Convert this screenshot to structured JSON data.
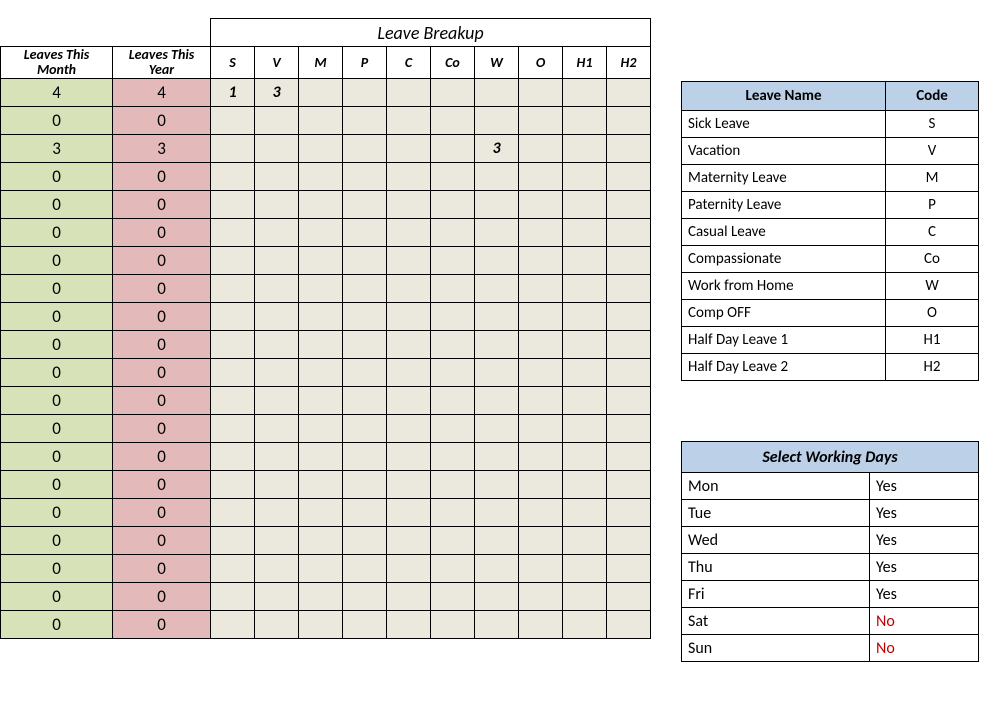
{
  "main": {
    "breakup_title": "Leave Breakup",
    "headers": {
      "month": "Leaves This Month",
      "year": "Leaves This Year",
      "codes": [
        "S",
        "V",
        "M",
        "P",
        "C",
        "Co",
        "W",
        "O",
        "H1",
        "H2"
      ]
    },
    "rows": [
      {
        "m": "4",
        "y": "4",
        "b": [
          "1",
          "3",
          "",
          "",
          "",
          "",
          "",
          "",
          "",
          ""
        ]
      },
      {
        "m": "0",
        "y": "0",
        "b": [
          "",
          "",
          "",
          "",
          "",
          "",
          "",
          "",
          "",
          ""
        ]
      },
      {
        "m": "3",
        "y": "3",
        "b": [
          "",
          "",
          "",
          "",
          "",
          "",
          "3",
          "",
          "",
          ""
        ]
      },
      {
        "m": "0",
        "y": "0",
        "b": [
          "",
          "",
          "",
          "",
          "",
          "",
          "",
          "",
          "",
          ""
        ]
      },
      {
        "m": "0",
        "y": "0",
        "b": [
          "",
          "",
          "",
          "",
          "",
          "",
          "",
          "",
          "",
          ""
        ]
      },
      {
        "m": "0",
        "y": "0",
        "b": [
          "",
          "",
          "",
          "",
          "",
          "",
          "",
          "",
          "",
          ""
        ]
      },
      {
        "m": "0",
        "y": "0",
        "b": [
          "",
          "",
          "",
          "",
          "",
          "",
          "",
          "",
          "",
          ""
        ]
      },
      {
        "m": "0",
        "y": "0",
        "b": [
          "",
          "",
          "",
          "",
          "",
          "",
          "",
          "",
          "",
          ""
        ]
      },
      {
        "m": "0",
        "y": "0",
        "b": [
          "",
          "",
          "",
          "",
          "",
          "",
          "",
          "",
          "",
          ""
        ]
      },
      {
        "m": "0",
        "y": "0",
        "b": [
          "",
          "",
          "",
          "",
          "",
          "",
          "",
          "",
          "",
          ""
        ]
      },
      {
        "m": "0",
        "y": "0",
        "b": [
          "",
          "",
          "",
          "",
          "",
          "",
          "",
          "",
          "",
          ""
        ]
      },
      {
        "m": "0",
        "y": "0",
        "b": [
          "",
          "",
          "",
          "",
          "",
          "",
          "",
          "",
          "",
          ""
        ]
      },
      {
        "m": "0",
        "y": "0",
        "b": [
          "",
          "",
          "",
          "",
          "",
          "",
          "",
          "",
          "",
          ""
        ]
      },
      {
        "m": "0",
        "y": "0",
        "b": [
          "",
          "",
          "",
          "",
          "",
          "",
          "",
          "",
          "",
          ""
        ]
      },
      {
        "m": "0",
        "y": "0",
        "b": [
          "",
          "",
          "",
          "",
          "",
          "",
          "",
          "",
          "",
          ""
        ]
      },
      {
        "m": "0",
        "y": "0",
        "b": [
          "",
          "",
          "",
          "",
          "",
          "",
          "",
          "",
          "",
          ""
        ]
      },
      {
        "m": "0",
        "y": "0",
        "b": [
          "",
          "",
          "",
          "",
          "",
          "",
          "",
          "",
          "",
          ""
        ]
      },
      {
        "m": "0",
        "y": "0",
        "b": [
          "",
          "",
          "",
          "",
          "",
          "",
          "",
          "",
          "",
          ""
        ]
      },
      {
        "m": "0",
        "y": "0",
        "b": [
          "",
          "",
          "",
          "",
          "",
          "",
          "",
          "",
          "",
          ""
        ]
      },
      {
        "m": "0",
        "y": "0",
        "b": [
          "",
          "",
          "",
          "",
          "",
          "",
          "",
          "",
          "",
          ""
        ]
      }
    ]
  },
  "legend": {
    "header_name": "Leave Name",
    "header_code": "Code",
    "items": [
      {
        "name": "Sick Leave",
        "code": "S"
      },
      {
        "name": "Vacation",
        "code": "V"
      },
      {
        "name": "Maternity Leave",
        "code": "M"
      },
      {
        "name": "Paternity Leave",
        "code": "P"
      },
      {
        "name": "Casual Leave",
        "code": "C"
      },
      {
        "name": "Compassionate",
        "code": "Co"
      },
      {
        "name": "Work from Home",
        "code": "W"
      },
      {
        "name": "Comp OFF",
        "code": "O"
      },
      {
        "name": "Half Day Leave 1",
        "code": "H1"
      },
      {
        "name": "Half Day Leave 2",
        "code": "H2"
      }
    ]
  },
  "workdays": {
    "title": "Select Working Days",
    "days": [
      {
        "day": "Mon",
        "val": "Yes",
        "no": false
      },
      {
        "day": "Tue",
        "val": "Yes",
        "no": false
      },
      {
        "day": "Wed",
        "val": "Yes",
        "no": false
      },
      {
        "day": "Thu",
        "val": "Yes",
        "no": false
      },
      {
        "day": "Fri",
        "val": "Yes",
        "no": false
      },
      {
        "day": "Sat",
        "val": "No",
        "no": true
      },
      {
        "day": "Sun",
        "val": "No",
        "no": true
      }
    ]
  }
}
